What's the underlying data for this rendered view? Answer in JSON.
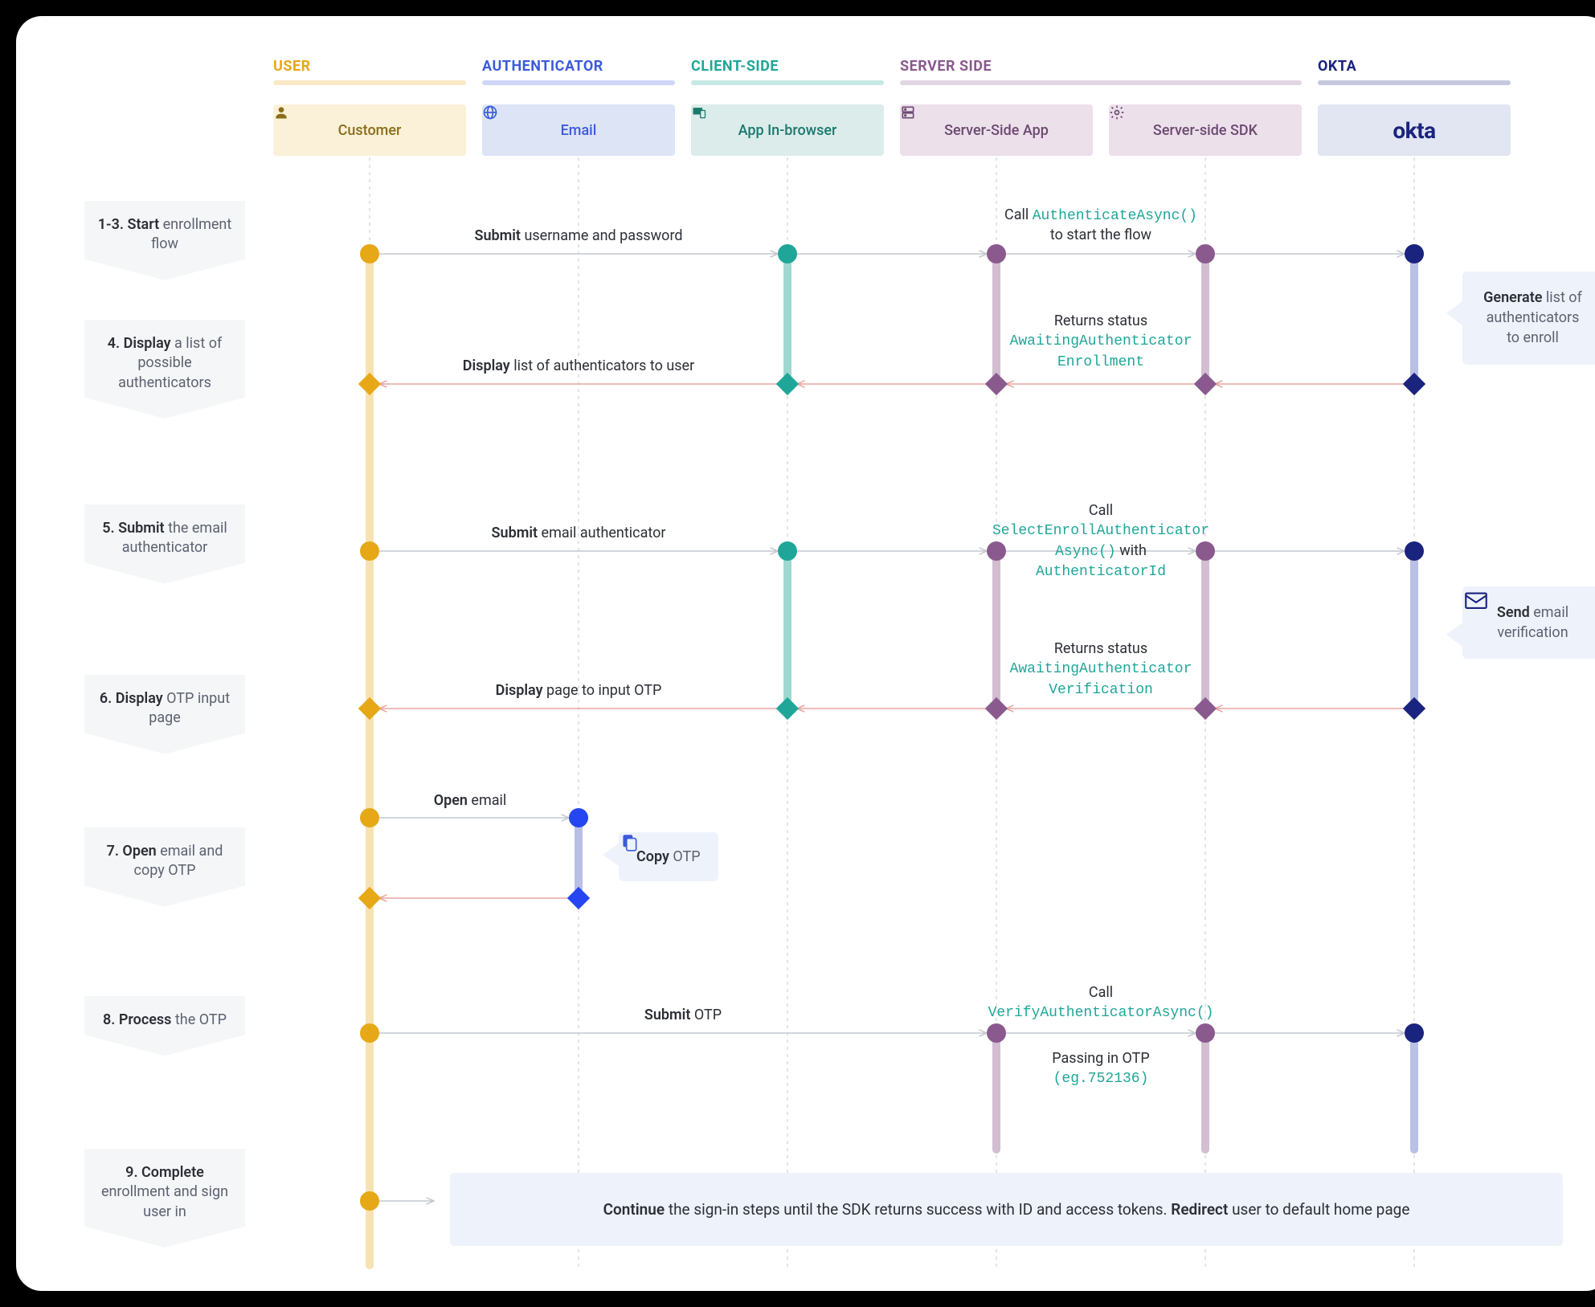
{
  "columns": {
    "user": {
      "label": "USER",
      "color": "#e6a817"
    },
    "authenticator": {
      "label": "AUTHENTICATOR",
      "color": "#3b5bdb"
    },
    "client_side": {
      "label": "CLIENT-SIDE",
      "color": "#1fa699"
    },
    "server_side": {
      "label": "SERVER SIDE",
      "color": "#8a5a8f"
    },
    "okta": {
      "label": "OKTA",
      "color": "#1a237e"
    }
  },
  "participants": {
    "customer": "Customer",
    "email": "Email",
    "app_browser": "App In-browser",
    "server_app": "Server-Side App",
    "server_sdk": "Server-side SDK",
    "okta": "okta"
  },
  "steps": {
    "s1": {
      "title": "1-3. Start",
      "sub": "enrollment flow"
    },
    "s4": {
      "title": "4. Display",
      "sub": "a list of possible authenticators"
    },
    "s5": {
      "title": "5. Submit",
      "sub": "the email authenticator"
    },
    "s6": {
      "title": "6. Display",
      "sub": "OTP input page"
    },
    "s7": {
      "title": "7. Open",
      "sub": "email and copy OTP"
    },
    "s8": {
      "title": "8. Process",
      "sub": "the OTP"
    },
    "s9": {
      "title": "9. Complete",
      "sub": "enrollment and sign user in"
    }
  },
  "messages": {
    "m1": {
      "bold": "Submit",
      "rest": " username and password"
    },
    "m2_pre": "Call ",
    "m2_code": "AuthenticateAsync()",
    "m2_post": "to start the flow",
    "m3_pre": "Returns status",
    "m3_code": "AwaitingAuthenticator\nEnrollment",
    "m4": {
      "bold": "Display",
      "rest": " list of authenticators to user"
    },
    "m5": {
      "bold": "Submit",
      "rest": " email authenticator"
    },
    "m6_pre": "Call",
    "m6_code1": "SelectEnrollAuthenticator\nAsync()",
    "m6_mid": " with ",
    "m6_code2": "AuthenticatorId",
    "m7_pre": "Returns status",
    "m7_code": "AwaitingAuthenticator\nVerification",
    "m8": {
      "bold": "Display",
      "rest": " page to input OTP"
    },
    "m9": {
      "bold": "Open",
      "rest": " email"
    },
    "m10": {
      "bold": "Copy",
      "rest": " OTP"
    },
    "m11": {
      "bold": "Submit",
      "rest": " OTP"
    },
    "m12_pre": "Call",
    "m12_code": "VerifyAuthenticatorAsync()",
    "m13_pre": "Passing in OTP",
    "m13_code": "(eg.752136)"
  },
  "callouts": {
    "c1": {
      "bold": "Generate",
      "rest": " list of authenticators to enroll"
    },
    "c2": {
      "bold": "Send",
      "rest": " email verification"
    }
  },
  "final": {
    "b1": "Continue",
    "t1": " the sign-in steps until the SDK returns success with ID and access tokens. ",
    "b2": "Redirect",
    "t2": " user to default home page"
  },
  "colors": {
    "yellow": "#e6a817",
    "blue": "#2546f0",
    "teal": "#1fa699",
    "purple": "#8a5a8f",
    "navy": "#1a237e",
    "pink_line": "#e8a5a0",
    "gray_line": "#d0d3da"
  },
  "lanes_x": {
    "customer": 440,
    "email": 700,
    "app_browser": 960,
    "server_app": 1220,
    "server_sdk": 1480,
    "okta": 1740
  }
}
